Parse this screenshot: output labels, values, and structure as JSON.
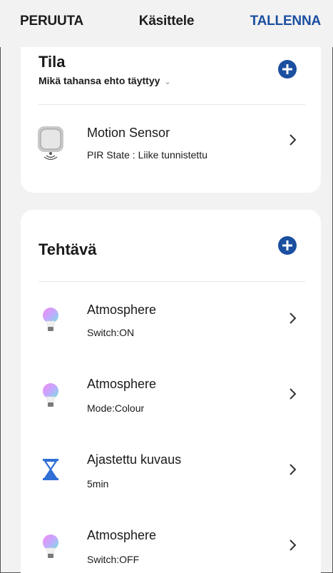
{
  "header": {
    "cancel_label": "PERUUTA",
    "title": "Käsittele",
    "save_label": "TALLENNA"
  },
  "condition": {
    "title": "Tila",
    "match_mode": "Mikä tahansa ehto täyttyy",
    "items": [
      {
        "name": "Motion Sensor",
        "detail": "PIR State : Liike tunnistettu",
        "icon": "motion-sensor-icon"
      }
    ]
  },
  "tasks": {
    "title": "Tehtävä",
    "items": [
      {
        "name": "Atmosphere",
        "detail": "Switch:ON",
        "icon": "bulb-icon"
      },
      {
        "name": "Atmosphere",
        "detail": "Mode:Colour",
        "icon": "bulb-icon"
      },
      {
        "name": "Ajastettu kuvaus",
        "detail": "5min",
        "icon": "hourglass-icon"
      },
      {
        "name": "Atmosphere",
        "detail": "Switch:OFF",
        "icon": "bulb-icon"
      }
    ]
  },
  "colors": {
    "accent": "#1b4fa0",
    "background": "#f2f2f2",
    "card": "#ffffff"
  }
}
